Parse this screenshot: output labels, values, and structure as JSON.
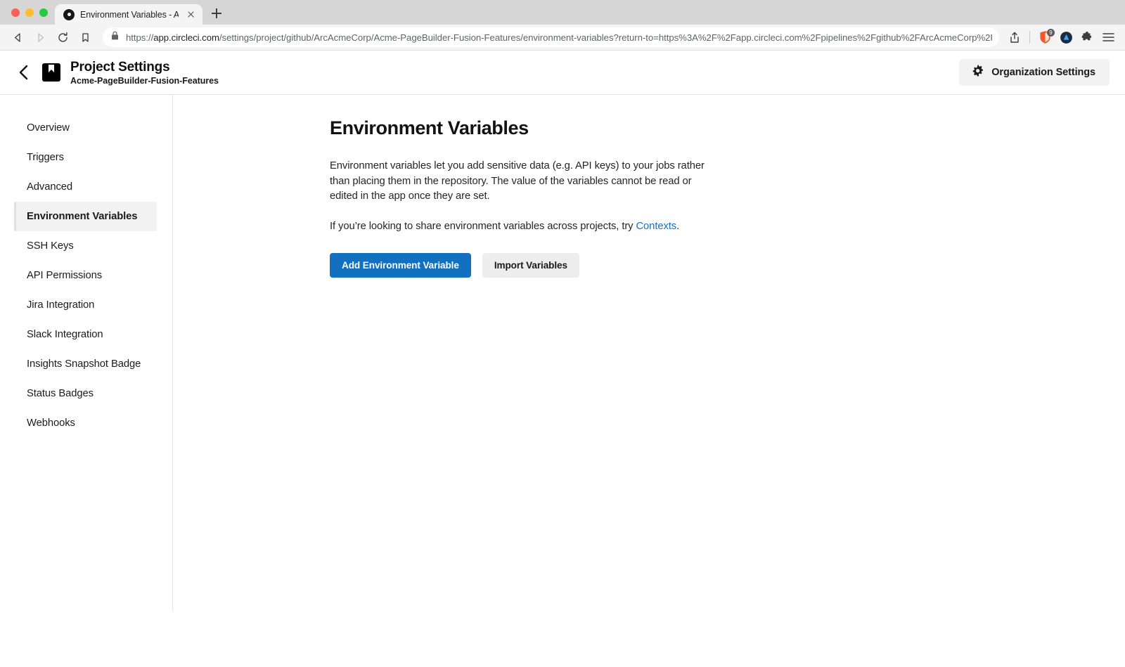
{
  "browser": {
    "traffic_lights": [
      "close",
      "minimize",
      "maximize"
    ],
    "tab": {
      "title": "Environment Variables - Acme-",
      "favicon": "circleci-favicon",
      "close_icon": "close-icon"
    },
    "new_tab_label": "+",
    "nav": {
      "back_icon": "back-arrow-icon",
      "forward_icon": "forward-arrow-icon",
      "reload_icon": "reload-icon",
      "bookmark_icon": "bookmark-icon"
    },
    "url": {
      "lock_icon": "lock-icon",
      "scheme": "https://",
      "host": "app.circleci.com",
      "path": "/settings/project/github/ArcAcmeCorp/Acme-PageBuilder-Fusion-Features/environment-variables?return-to=https%3A%2F%2Fapp.circleci.com%2Fpipelines%2Fgithub%2FArcAcmeCorp%2F…"
    },
    "actions": {
      "share_icon": "share-icon",
      "shields_icon": "brave-shields-icon",
      "shields_badge": "9",
      "rewards_icon": "brave-rewards-icon",
      "extensions_icon": "puzzle-piece-icon",
      "menu_icon": "hamburger-menu-icon"
    }
  },
  "header": {
    "back_icon": "chevron-left-icon",
    "project_icon": "project-bookmark-icon",
    "title": "Project Settings",
    "subtitle": "Acme-PageBuilder-Fusion-Features",
    "org_settings": {
      "icon": "gear-icon",
      "label": "Organization Settings"
    }
  },
  "sidebar": {
    "items": [
      {
        "label": "Overview",
        "active": false
      },
      {
        "label": "Triggers",
        "active": false
      },
      {
        "label": "Advanced",
        "active": false
      },
      {
        "label": "Environment Variables",
        "active": true
      },
      {
        "label": "SSH Keys",
        "active": false
      },
      {
        "label": "API Permissions",
        "active": false
      },
      {
        "label": "Jira Integration",
        "active": false
      },
      {
        "label": "Slack Integration",
        "active": false
      },
      {
        "label": "Insights Snapshot Badge",
        "active": false
      },
      {
        "label": "Status Badges",
        "active": false
      },
      {
        "label": "Webhooks",
        "active": false
      }
    ]
  },
  "main": {
    "heading": "Environment Variables",
    "paragraph1": "Environment variables let you add sensitive data (e.g. API keys) to your jobs rather than placing them in the repository. The value of the variables cannot be read or edited in the app once they are set.",
    "paragraph2_prefix": "If you’re looking to share environment variables across projects, try ",
    "paragraph2_link": "Contexts",
    "paragraph2_suffix": ".",
    "buttons": {
      "primary": "Add Environment Variable",
      "secondary": "Import Variables"
    }
  },
  "colors": {
    "accent_blue": "#1170c0",
    "link_blue": "#1670c4",
    "active_nav_bg": "#f2f2f2",
    "secondary_btn_bg": "#ededed",
    "chrome_tabstrip": "#d6d6d7",
    "chrome_toolbar": "#f4f4f5"
  }
}
